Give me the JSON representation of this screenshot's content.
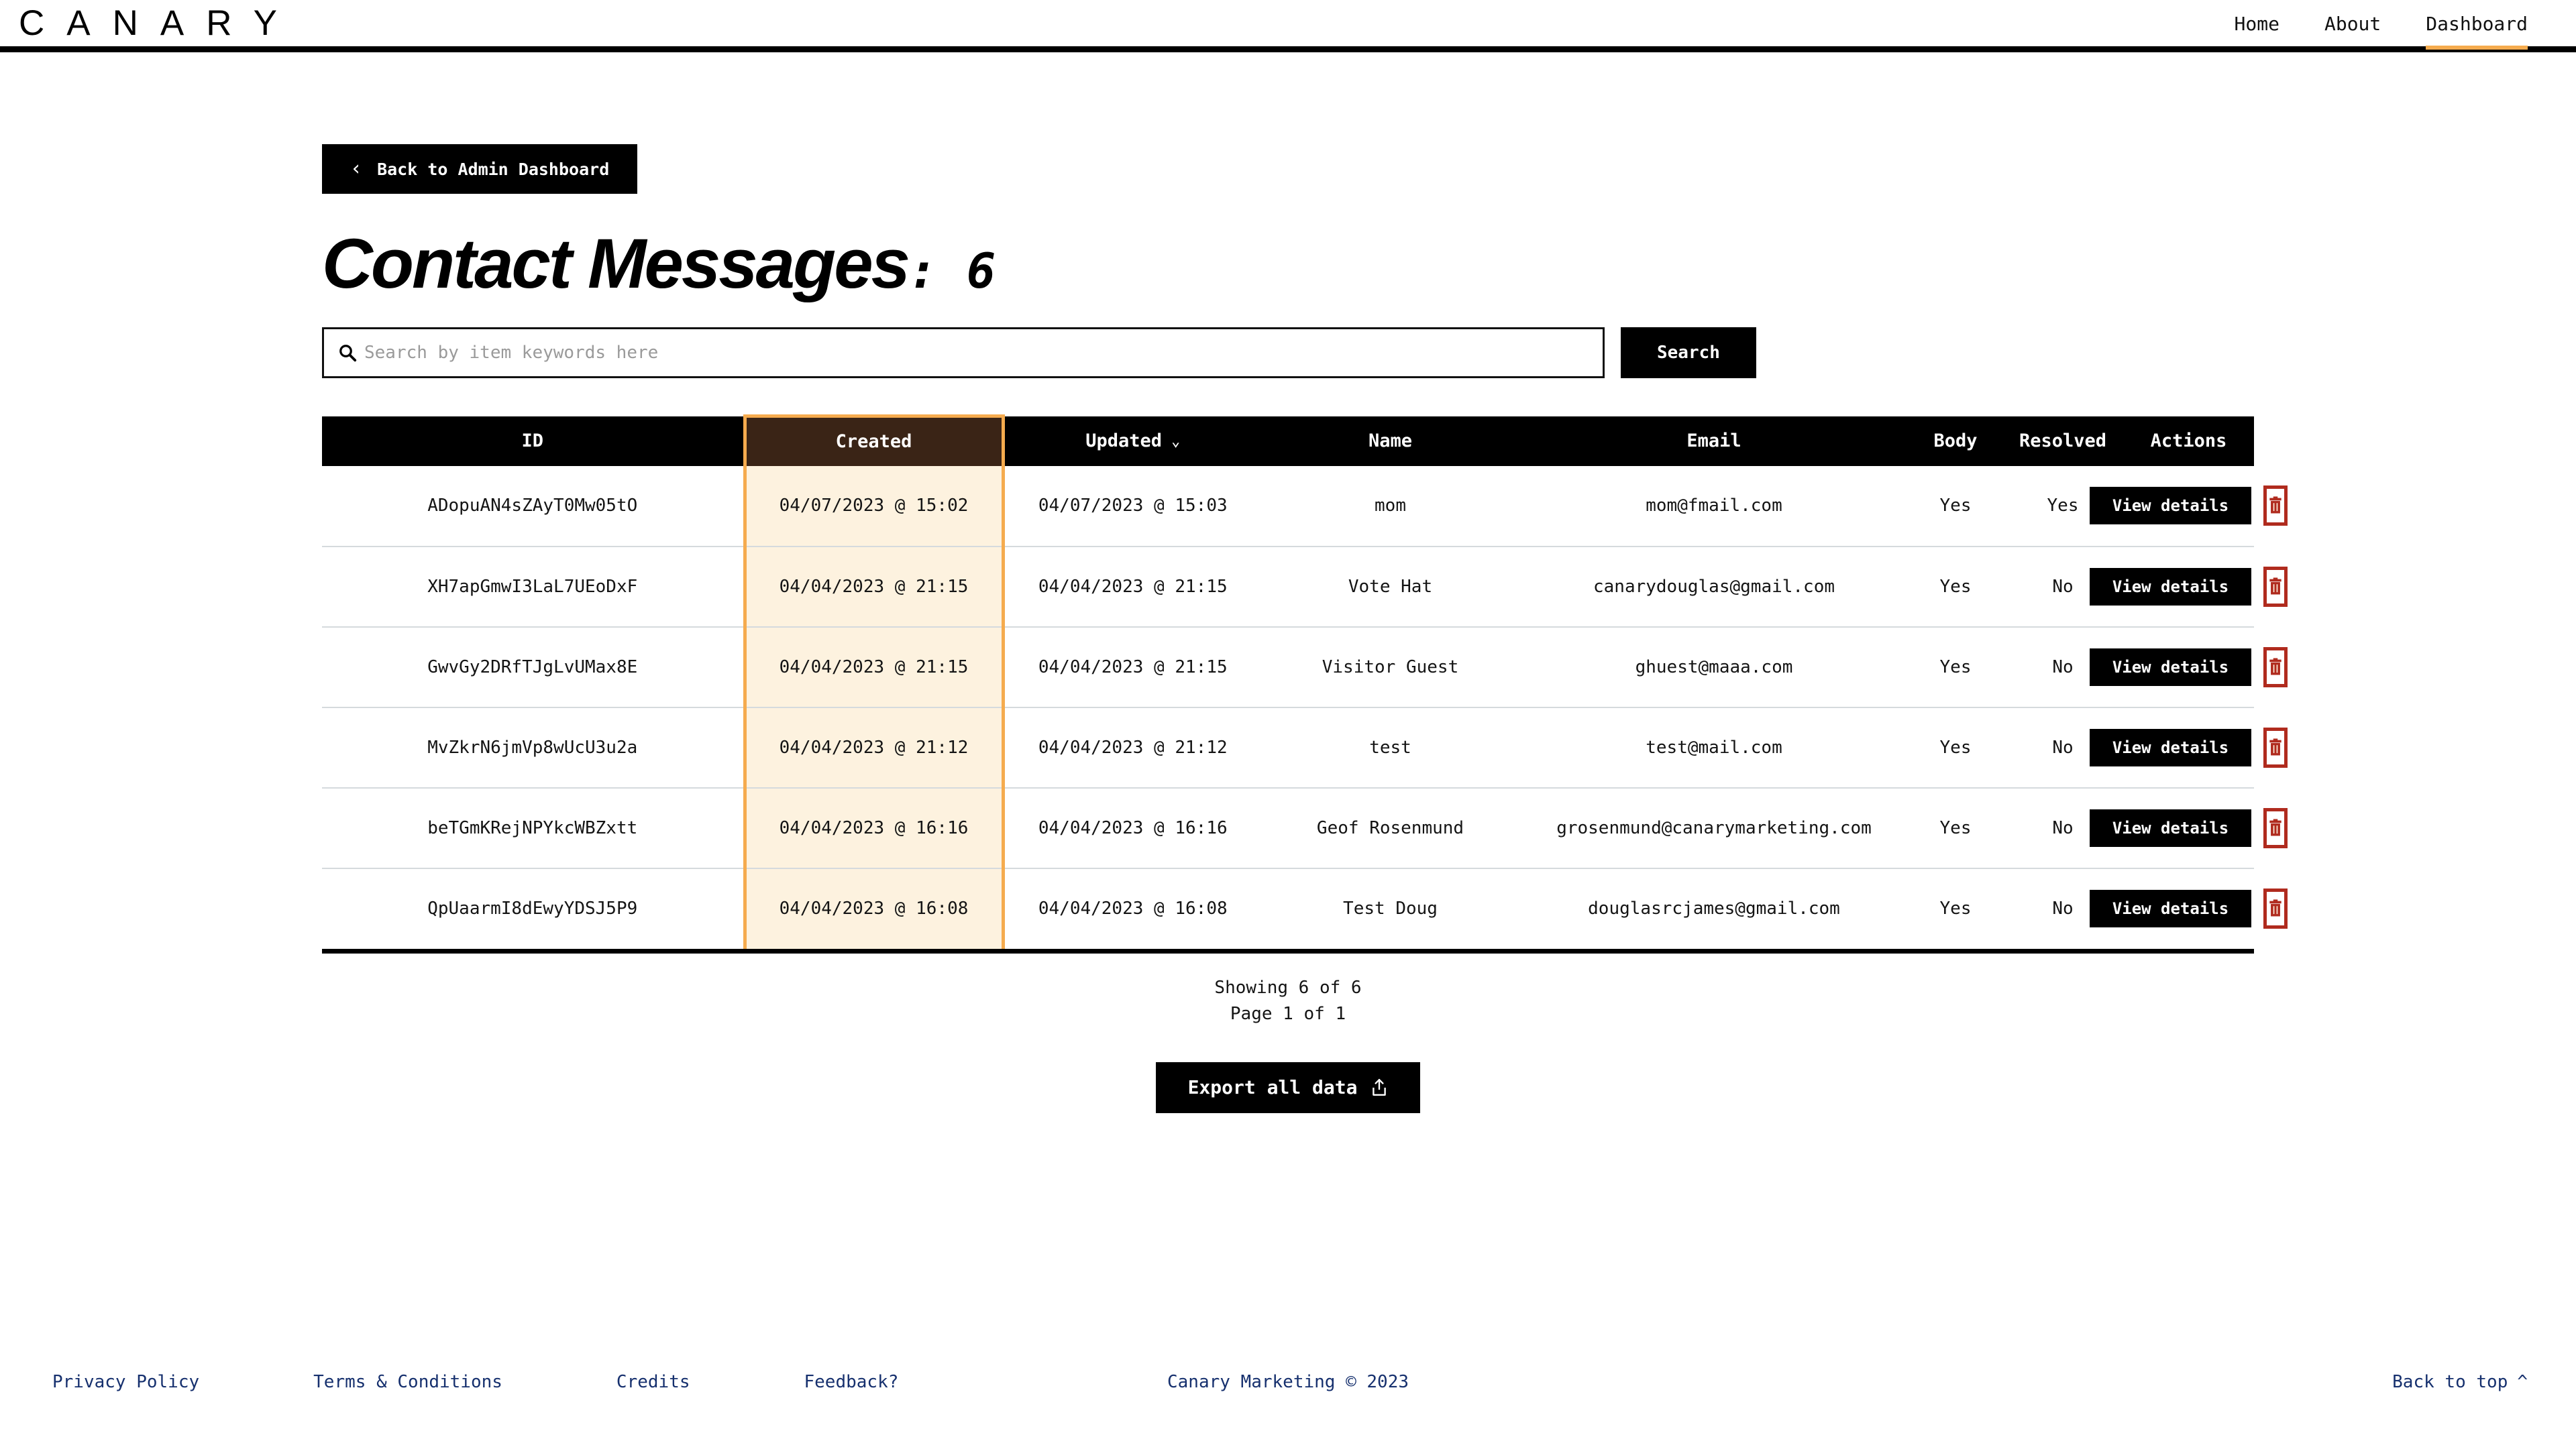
{
  "header": {
    "logo": "CANARY",
    "nav": [
      {
        "label": "Home",
        "active": false
      },
      {
        "label": "About",
        "active": false
      },
      {
        "label": "Dashboard",
        "active": true
      }
    ],
    "active_underline_color": "#f5ab4e"
  },
  "main": {
    "back_button": {
      "label": "Back to Admin Dashboard",
      "icon": "chevron-left-icon"
    },
    "title": "Contact Messages",
    "title_separator": ": ",
    "count": "6",
    "search": {
      "placeholder": "Search by item keywords here",
      "value": "",
      "button_label": "Search",
      "icon": "search-icon"
    },
    "table": {
      "columns": [
        {
          "key": "id",
          "label": "ID",
          "highlighted": false
        },
        {
          "key": "created",
          "label": "Created",
          "highlighted": true
        },
        {
          "key": "updated",
          "label": "Updated",
          "highlighted": false,
          "sort_icon": "chevron-down-icon"
        },
        {
          "key": "name",
          "label": "Name",
          "highlighted": false
        },
        {
          "key": "email",
          "label": "Email",
          "highlighted": false
        },
        {
          "key": "body",
          "label": "Body",
          "highlighted": false
        },
        {
          "key": "resolved",
          "label": "Resolved",
          "highlighted": false
        },
        {
          "key": "actions",
          "label": "Actions",
          "highlighted": false
        }
      ],
      "rows": [
        {
          "id": "ADopuAN4sZAyT0Mw05tO",
          "created": "04/07/2023 @ 15:02",
          "updated": "04/07/2023 @ 15:03",
          "name": "mom",
          "email": "mom@fmail.com",
          "body": "Yes",
          "resolved": "Yes"
        },
        {
          "id": "XH7apGmwI3LaL7UEoDxF",
          "created": "04/04/2023 @ 21:15",
          "updated": "04/04/2023 @ 21:15",
          "name": "Vote Hat",
          "email": "canarydouglas@gmail.com",
          "body": "Yes",
          "resolved": "No"
        },
        {
          "id": "GwvGy2DRfTJgLvUMax8E",
          "created": "04/04/2023 @ 21:15",
          "updated": "04/04/2023 @ 21:15",
          "name": "Visitor Guest",
          "email": "ghuest@maaa.com",
          "body": "Yes",
          "resolved": "No"
        },
        {
          "id": "MvZkrN6jmVp8wUcU3u2a",
          "created": "04/04/2023 @ 21:12",
          "updated": "04/04/2023 @ 21:12",
          "name": "test",
          "email": "test@mail.com",
          "body": "Yes",
          "resolved": "No"
        },
        {
          "id": "beTGmKRejNPYkcWBZxtt",
          "created": "04/04/2023 @ 16:16",
          "updated": "04/04/2023 @ 16:16",
          "name": "Geof Rosenmund",
          "email": "grosenmund@canarymarketing.com",
          "body": "Yes",
          "resolved": "No"
        },
        {
          "id": "QpUaarmI8dEwyYDSJ5P9",
          "created": "04/04/2023 @ 16:08",
          "updated": "04/04/2023 @ 16:08",
          "name": "Test Doug",
          "email": "douglasrcjames@gmail.com",
          "body": "Yes",
          "resolved": "No"
        }
      ],
      "row_action_labels": {
        "view": "View details",
        "delete_icon": "trash-icon"
      },
      "colors": {
        "header_bg": "#000000",
        "highlight_header_bg": "#3a2416",
        "highlight_cell_bg": "#fdf2df",
        "highlight_border": "#f5ab4e",
        "yes": "#1f7a1f",
        "no": "#b02b1e",
        "delete_border": "#b02b1e"
      }
    },
    "pagination": {
      "showing": "Showing 6 of 6",
      "page": "Page 1 of 1"
    },
    "export": {
      "label": "Export all data",
      "icon": "export-icon"
    }
  },
  "footer": {
    "links": [
      {
        "label": "Privacy Policy"
      },
      {
        "label": "Terms & Conditions"
      },
      {
        "label": "Credits"
      },
      {
        "label": "Feedback?"
      }
    ],
    "copyright": "Canary Marketing © 2023",
    "back_to_top": {
      "label": "Back to top",
      "icon": "chevron-up-icon"
    },
    "link_color": "#16306e"
  }
}
